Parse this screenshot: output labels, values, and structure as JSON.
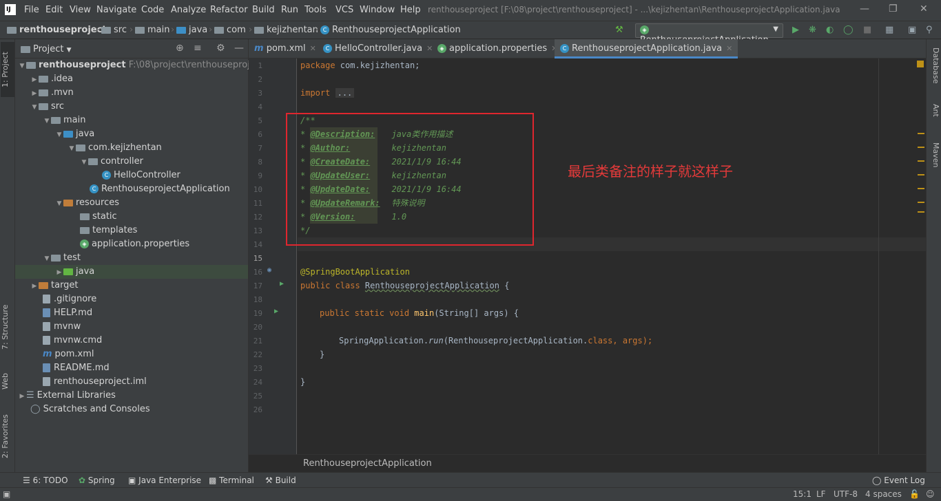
{
  "app": {
    "logo": "IJ",
    "title": "renthouseproject [F:\\08\\project\\renthouseproject] - ...\\kejizhentan\\RenthouseprojectApplication.java"
  },
  "menu": [
    "File",
    "Edit",
    "View",
    "Navigate",
    "Code",
    "Analyze",
    "Refactor",
    "Build",
    "Run",
    "Tools",
    "VCS",
    "Window",
    "Help"
  ],
  "breadcrumb": [
    "renthouseproject",
    "src",
    "main",
    "java",
    "com",
    "kejizhentan",
    "RenthouseprojectApplication"
  ],
  "run_config": "RenthouseprojectApplication",
  "left_strip": {
    "project": "1: Project",
    "structure": "7: Structure",
    "web": "Web",
    "favorites": "2: Favorites"
  },
  "right_strip": {
    "database": "Database",
    "ant": "Ant",
    "maven": "Maven"
  },
  "project_panel": {
    "title": "Project",
    "tree": [
      {
        "label": "renthouseproject",
        "extra": "F:\\08\\project\\renthouseproject"
      },
      {
        "label": ".idea"
      },
      {
        "label": ".mvn"
      },
      {
        "label": "src"
      },
      {
        "label": "main"
      },
      {
        "label": "java"
      },
      {
        "label": "com.kejizhentan"
      },
      {
        "label": "controller"
      },
      {
        "label": "HelloController"
      },
      {
        "label": "RenthouseprojectApplication"
      },
      {
        "label": "resources"
      },
      {
        "label": "static"
      },
      {
        "label": "templates"
      },
      {
        "label": "application.properties"
      },
      {
        "label": "test"
      },
      {
        "label": "java"
      },
      {
        "label": "target"
      },
      {
        "label": ".gitignore"
      },
      {
        "label": "HELP.md"
      },
      {
        "label": "mvnw"
      },
      {
        "label": "mvnw.cmd"
      },
      {
        "label": "pom.xml"
      },
      {
        "label": "README.md"
      },
      {
        "label": "renthouseproject.iml"
      },
      {
        "label": "External Libraries"
      },
      {
        "label": "Scratches and Consoles"
      }
    ]
  },
  "tabs": [
    "pom.xml",
    "HelloController.java",
    "application.properties",
    "RenthouseprojectApplication.java"
  ],
  "code": {
    "l1_kw": "package",
    "l1_rest": " com.kejizhentan;",
    "l3_kw": "import",
    "l3_fold": "...",
    "l6": "/**",
    "doc_rows": [
      {
        "tag": "@Description:",
        "value": "java类作用描述"
      },
      {
        "tag": "@Author:",
        "value": "kejizhentan"
      },
      {
        "tag": "@CreateDate:",
        "value": "2021/1/9 16:44"
      },
      {
        "tag": "@UpdateUser:",
        "value": "kejizhentan"
      },
      {
        "tag": "@UpdateDate:",
        "value": "2021/1/9 16:44"
      },
      {
        "tag": "@UpdateRemark:",
        "value": "特殊说明"
      },
      {
        "tag": "@Version:",
        "value": "1.0"
      }
    ],
    "l14": "*/",
    "l17": "@SpringBootApplication",
    "l18_kw": "public class ",
    "l18_name": "RenthouseprojectApplication",
    "l18_rest": " {",
    "l20_kw": "public static void ",
    "l20_fn": "main",
    "l20_rest": "(String[] args) {",
    "l22_a": "SpringApplication.",
    "l22_run": "run",
    "l22_b": "(RenthouseprojectApplication.",
    "l22_cls": "class",
    "l22_c": ", args);",
    "l23": "}",
    "l25": "}"
  },
  "annotation_text": "最后类备注的样子就这样子",
  "editor_breadcrumb": "RenthouseprojectApplication",
  "bottom_tools": [
    "6: TODO",
    "Spring",
    "Java Enterprise",
    "Terminal",
    "Build",
    "Event Log"
  ],
  "status": {
    "position": "15:1",
    "line_sep": "LF",
    "encoding": "UTF-8",
    "indent": "4 spaces"
  }
}
